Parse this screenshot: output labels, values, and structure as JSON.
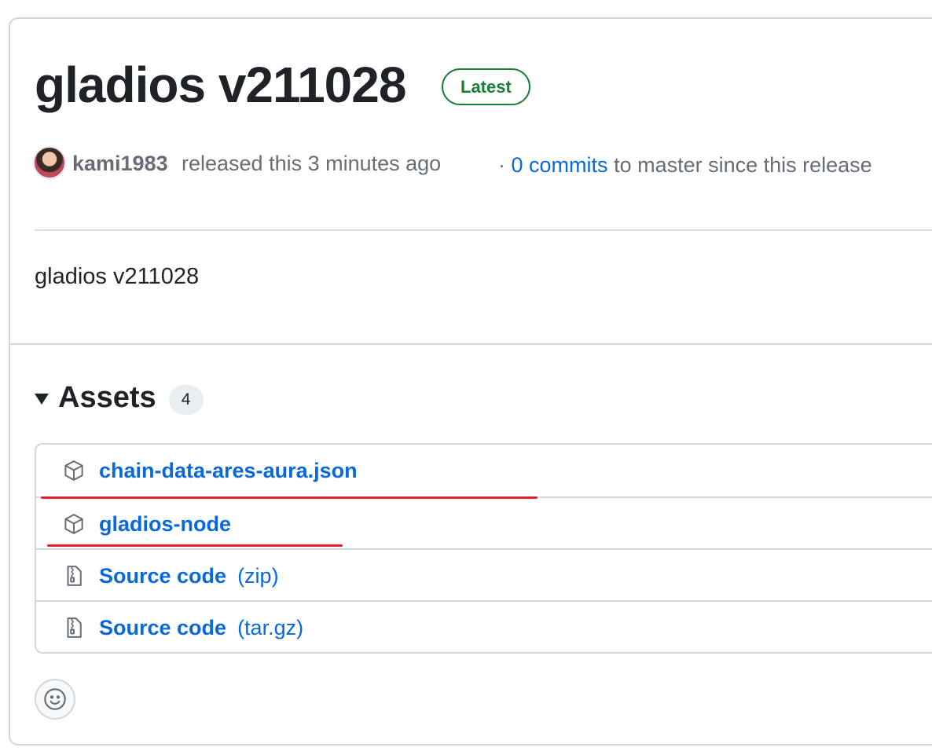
{
  "release": {
    "title": "gladios v211028",
    "badge": "Latest",
    "author": "kami1983",
    "released_text": "released this 3 minutes ago",
    "separator": "·",
    "commits_link": "0 commits",
    "commits_suffix": "to master since this release",
    "body": "gladios v211028"
  },
  "assets": {
    "title": "Assets",
    "count": "4",
    "items": [
      {
        "name": "chain-data-ares-aura.json",
        "kind": "",
        "icon": "package-icon"
      },
      {
        "name": "gladios-node",
        "kind": "",
        "icon": "package-icon"
      },
      {
        "name": "Source code",
        "kind": "(zip)",
        "icon": "file-zip-icon"
      },
      {
        "name": "Source code",
        "kind": "(tar.gz)",
        "icon": "file-zip-icon"
      }
    ]
  },
  "colors": {
    "link": "#0969da",
    "badge": "#1a7f37",
    "annotation": "#e5202b"
  }
}
